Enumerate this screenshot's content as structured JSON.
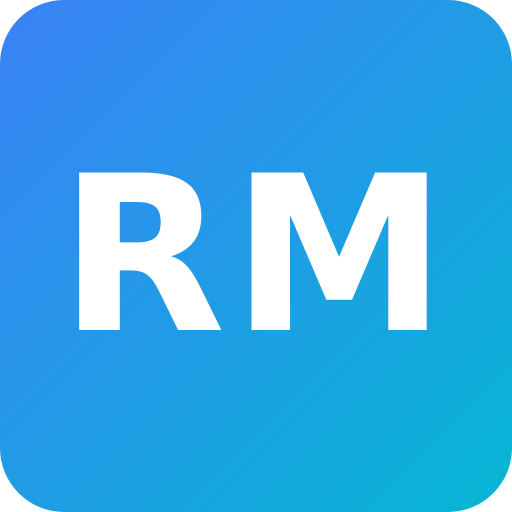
{
  "icon": {
    "monogram": "RM",
    "colors": {
      "gradient_start": "#3b82f6",
      "gradient_end": "#06b6d4",
      "text": "#ffffff"
    }
  }
}
